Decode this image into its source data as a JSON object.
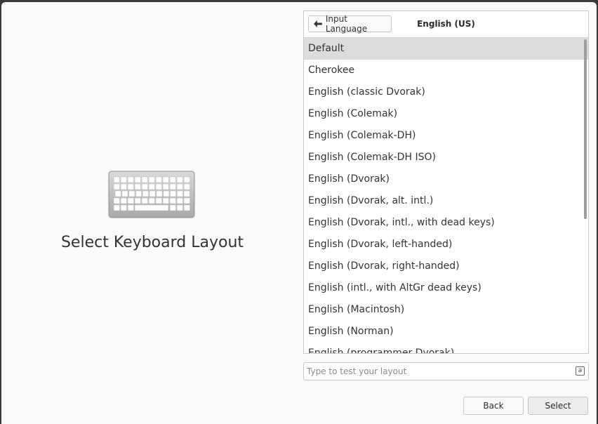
{
  "left": {
    "title": "Select Keyboard Layout",
    "icon": "keyboard-icon"
  },
  "panel": {
    "back_button_label": "Input Language",
    "back_button_icon": "arrow-left-icon",
    "header_title": "English (US)",
    "selected_index": 0,
    "layouts": [
      "Default",
      "Cherokee",
      "English (classic Dvorak)",
      "English (Colemak)",
      "English (Colemak-DH)",
      "English (Colemak-DH ISO)",
      "English (Dvorak)",
      "English (Dvorak, alt. intl.)",
      "English (Dvorak, intl., with dead keys)",
      "English (Dvorak, left-handed)",
      "English (Dvorak, right-handed)",
      "English (intl., with AltGr dead keys)",
      "English (Macintosh)",
      "English (Norman)",
      "English (programmer Dvorak)"
    ]
  },
  "test_field": {
    "placeholder": "Type to test your layout",
    "value": "",
    "icon": "keyboard-small-icon",
    "icon_glyph": "a"
  },
  "footer": {
    "back_label": "Back",
    "select_label": "Select"
  }
}
